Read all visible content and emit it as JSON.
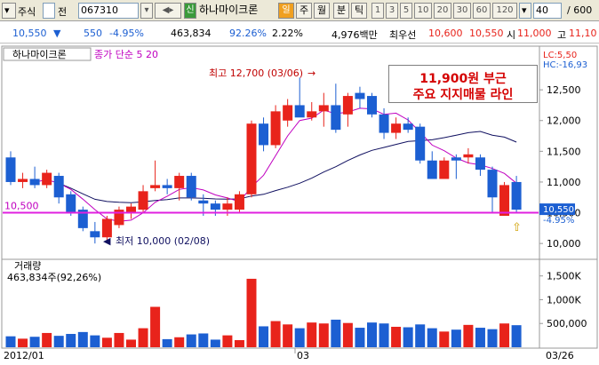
{
  "toolbar": {
    "market_label": "주식",
    "market_btn": "전",
    "code": "067310",
    "new_label": "신",
    "stock_name": "하나마이크론",
    "period_active": "일",
    "period_week": "주",
    "period_month": "월",
    "minute": "분",
    "tick": "틱",
    "intervals": [
      "1",
      "3",
      "5",
      "10",
      "20",
      "30",
      "60",
      "120"
    ],
    "count": "40",
    "total": "/ 600"
  },
  "info": {
    "price": "10,550",
    "arrow": "▼",
    "change": "550",
    "change_pct": "-4.95%",
    "volume": "463,834",
    "vol_ratio": "92.26%",
    "turnover": "2.22%",
    "amount": "4,976백만",
    "best_label": "최우선",
    "best_ask": "10,600",
    "best_bid": "10,550",
    "open_label": "시",
    "open": "11,000",
    "high_label": "고",
    "high": "11,10"
  },
  "price_panel": {
    "title": "하나마이크론",
    "ma_label": "종가 단순 5  20",
    "lc": "LC:5,50",
    "hc": "HC:-16,93",
    "support_label": "10,500",
    "high_annot": "최고 12,700 (03/06)",
    "low_annot": "최저 10,000 (02/08)",
    "current_price_tag": "10,550",
    "current_pct_tag": "-4.95%",
    "y_ticks": [
      "12,500",
      "12,000",
      "11,500",
      "11,000",
      "10,500",
      "10,000"
    ]
  },
  "annotation": {
    "line1": "11,900원 부근",
    "line2": "주요 지지매물 라인"
  },
  "volume_panel": {
    "title": "거래량",
    "value": "463,834주(92,26%)",
    "y_ticks": [
      "1,500K",
      "1,000K",
      "500,000"
    ]
  },
  "x_axis": {
    "labels": [
      "2012/01",
      "03",
      "03/26"
    ]
  },
  "colors": {
    "up": "#e8231b",
    "down": "#1c5fd2",
    "ma5": "#c000c0",
    "ma20": "#101060",
    "support": "#e020e0"
  },
  "chart_data": {
    "type": "candlestick",
    "ylim": [
      9800,
      12950
    ],
    "support_level": 10500,
    "candles": [
      {
        "o": 11400,
        "h": 11500,
        "l": 10950,
        "c": 11000
      },
      {
        "o": 11000,
        "h": 11150,
        "l": 10900,
        "c": 11050
      },
      {
        "o": 11050,
        "h": 11250,
        "l": 10900,
        "c": 10950
      },
      {
        "o": 10950,
        "h": 11200,
        "l": 10900,
        "c": 11150
      },
      {
        "o": 11100,
        "h": 11150,
        "l": 10650,
        "c": 10750
      },
      {
        "o": 10800,
        "h": 10850,
        "l": 10450,
        "c": 10500
      },
      {
        "o": 10550,
        "h": 10600,
        "l": 10200,
        "c": 10250
      },
      {
        "o": 10200,
        "h": 10350,
        "l": 10000,
        "c": 10100
      },
      {
        "o": 10100,
        "h": 10450,
        "l": 10050,
        "c": 10400
      },
      {
        "o": 10300,
        "h": 10600,
        "l": 10250,
        "c": 10550
      },
      {
        "o": 10500,
        "h": 10650,
        "l": 10400,
        "c": 10600
      },
      {
        "o": 10550,
        "h": 10950,
        "l": 10500,
        "c": 10850
      },
      {
        "o": 10900,
        "h": 11350,
        "l": 10850,
        "c": 10950
      },
      {
        "o": 10950,
        "h": 11050,
        "l": 10800,
        "c": 10900
      },
      {
        "o": 10900,
        "h": 11150,
        "l": 10700,
        "c": 11100
      },
      {
        "o": 11100,
        "h": 11150,
        "l": 10700,
        "c": 10750
      },
      {
        "o": 10700,
        "h": 10800,
        "l": 10450,
        "c": 10650
      },
      {
        "o": 10650,
        "h": 10700,
        "l": 10450,
        "c": 10550
      },
      {
        "o": 10550,
        "h": 10750,
        "l": 10450,
        "c": 10650
      },
      {
        "o": 10550,
        "h": 10850,
        "l": 10500,
        "c": 10800
      },
      {
        "o": 10800,
        "h": 12000,
        "l": 10750,
        "c": 11950
      },
      {
        "o": 11950,
        "h": 12050,
        "l": 11500,
        "c": 11600
      },
      {
        "o": 11600,
        "h": 12250,
        "l": 11550,
        "c": 12150
      },
      {
        "o": 12000,
        "h": 12350,
        "l": 11900,
        "c": 12250
      },
      {
        "o": 12250,
        "h": 12700,
        "l": 12100,
        "c": 12050
      },
      {
        "o": 12050,
        "h": 12300,
        "l": 12000,
        "c": 12150
      },
      {
        "o": 12150,
        "h": 12450,
        "l": 11900,
        "c": 12250
      },
      {
        "o": 12250,
        "h": 12600,
        "l": 11800,
        "c": 11850
      },
      {
        "o": 12100,
        "h": 12450,
        "l": 11900,
        "c": 12400
      },
      {
        "o": 12450,
        "h": 12550,
        "l": 12200,
        "c": 12350
      },
      {
        "o": 12400,
        "h": 12450,
        "l": 12050,
        "c": 12100
      },
      {
        "o": 12100,
        "h": 12200,
        "l": 11700,
        "c": 11800
      },
      {
        "o": 11800,
        "h": 12050,
        "l": 11700,
        "c": 11950
      },
      {
        "o": 11950,
        "h": 12050,
        "l": 11800,
        "c": 11850
      },
      {
        "o": 11900,
        "h": 11950,
        "l": 11300,
        "c": 11350
      },
      {
        "o": 11350,
        "h": 11500,
        "l": 11050,
        "c": 11050
      },
      {
        "o": 11050,
        "h": 11400,
        "l": 11050,
        "c": 11350
      },
      {
        "o": 11400,
        "h": 11450,
        "l": 11050,
        "c": 11350
      },
      {
        "o": 11400,
        "h": 11550,
        "l": 11300,
        "c": 11450
      },
      {
        "o": 11400,
        "h": 11450,
        "l": 11100,
        "c": 11200
      },
      {
        "o": 11200,
        "h": 11250,
        "l": 10500,
        "c": 10750
      },
      {
        "o": 10450,
        "h": 11000,
        "l": 10450,
        "c": 10950
      },
      {
        "o": 11000,
        "h": 11100,
        "l": 10500,
        "c": 10550
      }
    ],
    "volumes": [
      230000,
      180000,
      220000,
      300000,
      240000,
      280000,
      320000,
      250000,
      200000,
      300000,
      160000,
      400000,
      850000,
      170000,
      210000,
      270000,
      290000,
      160000,
      250000,
      150000,
      1440000,
      440000,
      550000,
      480000,
      400000,
      520000,
      500000,
      580000,
      510000,
      410000,
      520000,
      500000,
      430000,
      420000,
      480000,
      400000,
      330000,
      370000,
      470000,
      410000,
      380000,
      500000,
      463834
    ]
  }
}
